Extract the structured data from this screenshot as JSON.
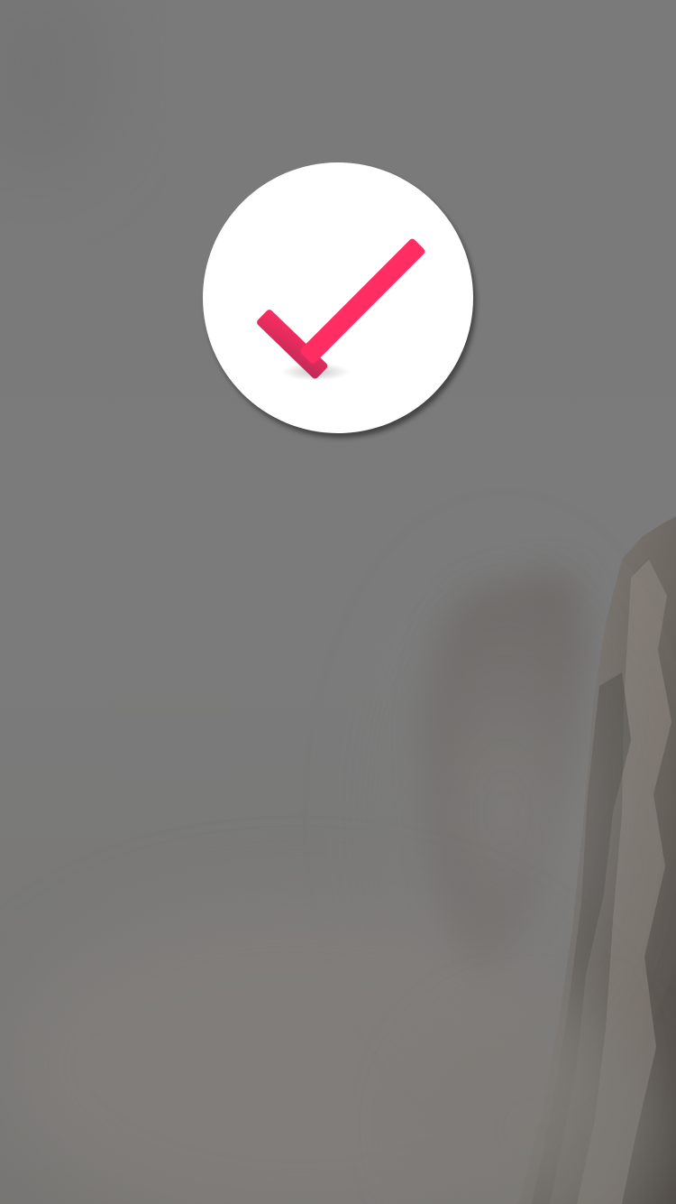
{
  "screen": {
    "background_color": "#7b7b7b",
    "scene": "fog-cliff-background"
  },
  "success_badge": {
    "icon": "checkmark-icon",
    "badge_color": "#ffffff",
    "check_color": "#ff2d62",
    "check_shade_color": "#c9285a"
  }
}
